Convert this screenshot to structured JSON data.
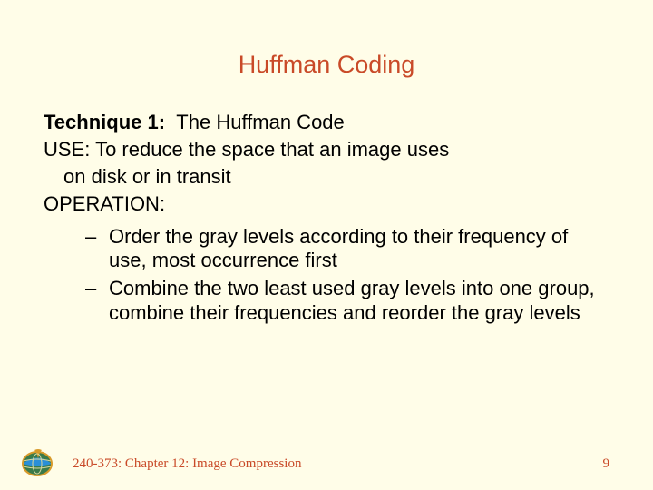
{
  "title": "Huffman Coding",
  "technique_label": "Technique 1:",
  "technique_name": "The Huffman Code",
  "use_line1": "USE: To reduce the space that an image uses",
  "use_line2": "on disk or in transit",
  "operation_label": "OPERATION:",
  "bullets": [
    "Order the gray levels according to their frequency of use, most occurrence first",
    "Combine the two least used gray levels into one group, combine their frequencies and reorder the gray levels"
  ],
  "footer": "240-373: Chapter 12: Image Compression",
  "page_number": "9"
}
